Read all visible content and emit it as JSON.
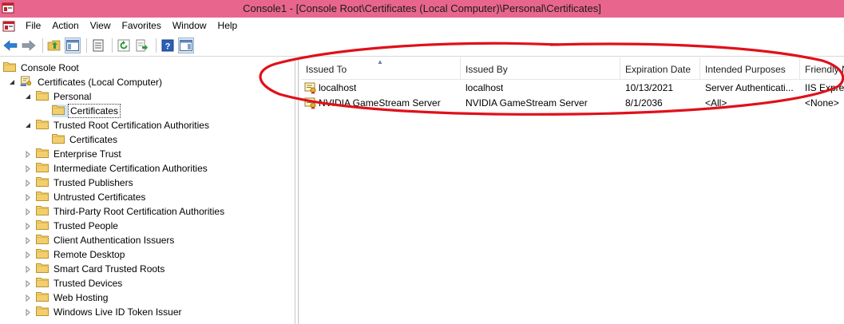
{
  "window": {
    "title": "Console1 - [Console Root\\Certificates (Local Computer)\\Personal\\Certificates]",
    "titlebar_color": "#e8668e"
  },
  "menu": {
    "items": [
      "File",
      "Action",
      "View",
      "Favorites",
      "Window",
      "Help"
    ]
  },
  "toolbar": {
    "buttons": [
      "back-arrow-icon",
      "forward-arrow-icon",
      "up-folder-icon",
      "show-hide-console-tree-icon",
      "properties-icon",
      "refresh-icon",
      "export-list-icon",
      "help-icon",
      "show-hide-action-pane-icon"
    ]
  },
  "tree": {
    "items": [
      {
        "label": "Console Root",
        "expander": "none"
      },
      {
        "label": "Certificates (Local Computer)",
        "expander": "expanded"
      },
      {
        "label": "Personal",
        "expander": "expanded"
      },
      {
        "label": "Certificates",
        "expander": "none",
        "selected": true
      },
      {
        "label": "Trusted Root Certification Authorities",
        "expander": "expanded"
      },
      {
        "label": "Certificates",
        "expander": "none"
      },
      {
        "label": "Enterprise Trust",
        "expander": "collapsed"
      },
      {
        "label": "Intermediate Certification Authorities",
        "expander": "collapsed"
      },
      {
        "label": "Trusted Publishers",
        "expander": "collapsed"
      },
      {
        "label": "Untrusted Certificates",
        "expander": "collapsed"
      },
      {
        "label": "Third-Party Root Certification Authorities",
        "expander": "collapsed"
      },
      {
        "label": "Trusted People",
        "expander": "collapsed"
      },
      {
        "label": "Client Authentication Issuers",
        "expander": "collapsed"
      },
      {
        "label": "Remote Desktop",
        "expander": "collapsed"
      },
      {
        "label": "Smart Card Trusted Roots",
        "expander": "collapsed"
      },
      {
        "label": "Trusted Devices",
        "expander": "collapsed"
      },
      {
        "label": "Web Hosting",
        "expander": "collapsed"
      },
      {
        "label": "Windows Live ID Token Issuer",
        "expander": "collapsed"
      }
    ]
  },
  "list": {
    "columns": [
      "Issued To",
      "Issued By",
      "Expiration Date",
      "Intended Purposes",
      "Friendly N"
    ],
    "sorted_column": "Issued To",
    "rows": [
      {
        "issued_to": "localhost",
        "issued_by": "localhost",
        "expiration": "10/13/2021",
        "purposes": "Server Authenticati...",
        "friendly": "IIS Express"
      },
      {
        "issued_to": "NVIDIA GameStream Server",
        "issued_by": "NVIDIA GameStream Server",
        "expiration": "8/1/2036",
        "purposes": "<All>",
        "friendly": "<None>"
      }
    ]
  },
  "annotation": {
    "shape": "hand-drawn-ellipse",
    "color": "#e0101a"
  }
}
